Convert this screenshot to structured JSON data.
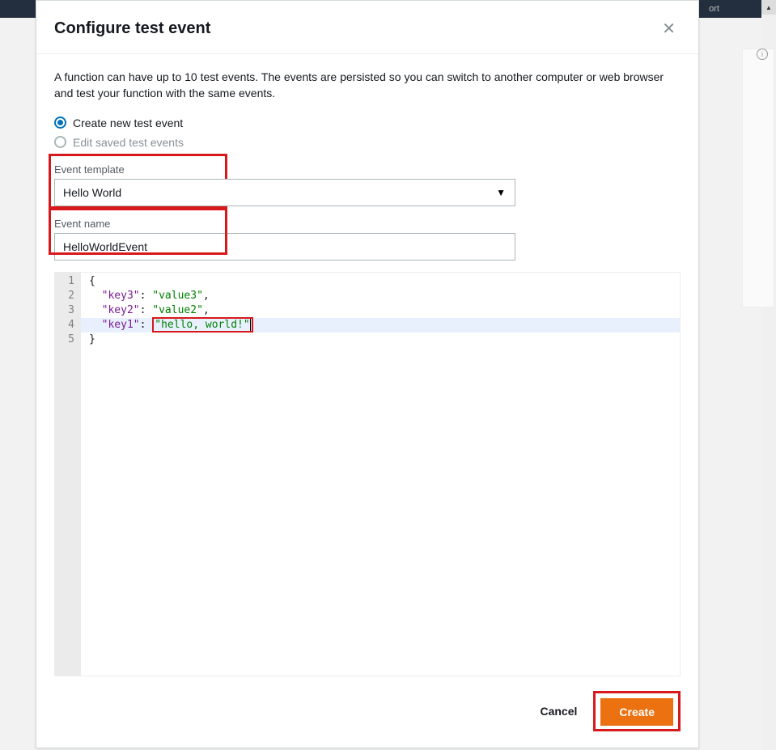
{
  "modal": {
    "title": "Configure test event",
    "description": "A function can have up to 10 test events. The events are persisted so you can switch to another computer or web browser and test your function with the same events.",
    "radios": {
      "create": "Create new test event",
      "edit": "Edit saved test events"
    },
    "template_label": "Event template",
    "template_value": "Hello World",
    "name_label": "Event name",
    "name_value": "HelloWorldEvent",
    "code": {
      "line_numbers": [
        "1",
        "2",
        "3",
        "4",
        "5"
      ],
      "l1": "{",
      "l2_key": "\"key3\"",
      "l2_val": "\"value3\"",
      "l3_key": "\"key2\"",
      "l3_val": "\"value2\"",
      "l4_key": "\"key1\"",
      "l4_val": "\"hello, world!\"",
      "l5": "}"
    },
    "footer": {
      "cancel": "Cancel",
      "create": "Create"
    }
  },
  "background": {
    "toolbar_hint": "ort"
  }
}
